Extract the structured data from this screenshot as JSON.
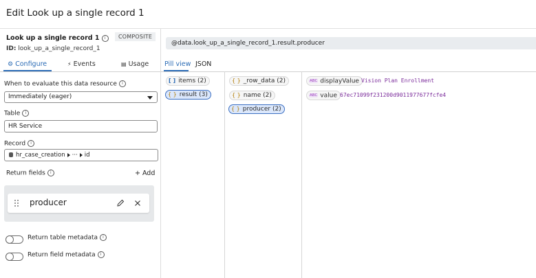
{
  "header": {
    "title": "Edit Look up a single record 1"
  },
  "resource": {
    "name": "Look up a single record 1",
    "id_label": "ID:",
    "id_value": "look_up_a_single_record_1",
    "badge": "COMPOSITE"
  },
  "config_tabs": [
    {
      "label": "Configure",
      "icon": "gear-icon"
    },
    {
      "label": "Events",
      "icon": "bolt-icon"
    },
    {
      "label": "Usage",
      "icon": "grid-icon"
    }
  ],
  "form": {
    "evaluate_label": "When to evaluate this data resource",
    "evaluate_value": "Immediately (eager)",
    "table_label": "Table",
    "table_value": "HR Service",
    "record_label": "Record",
    "record_path": {
      "segment1": "hr_case_creation",
      "ellipsis": "···",
      "segment3": "id"
    },
    "return_fields_label": "Return fields",
    "add_label": "+ Add",
    "return_fields": [
      "producer"
    ],
    "toggles": [
      {
        "label": "Return table metadata",
        "on": false
      },
      {
        "label": "Return field metadata",
        "on": false
      }
    ]
  },
  "preview": {
    "path": "@data.look_up_a_single_record_1.result.producer",
    "tabs": [
      "Pill view",
      "JSON"
    ],
    "col1": [
      {
        "type_glyph": "[ ]",
        "label": "items",
        "count": "(2)",
        "selected": false
      },
      {
        "type_glyph": "{ }",
        "label": "result",
        "count": "(3)",
        "selected": true
      }
    ],
    "col2": [
      {
        "type_glyph": "{ }",
        "label": "_row_data",
        "count": "(2)",
        "selected": false
      },
      {
        "type_glyph": "{ }",
        "label": "name",
        "count": "(2)",
        "selected": false
      },
      {
        "type_glyph": "{ }",
        "label": "producer",
        "count": "(2)",
        "selected": true
      }
    ],
    "col3": [
      {
        "type_glyph": "ABC",
        "label": "displayValue",
        "value": "Vision Plan Enrollment"
      },
      {
        "type_glyph": "ABC",
        "label": "value",
        "value": "67ec71099f231200d9011977677fcfe4"
      }
    ]
  },
  "colors": {
    "accent": "#2a6bb5",
    "selected_pill_bg": "#dbe7fb",
    "value_text": "#7a2a9a"
  }
}
